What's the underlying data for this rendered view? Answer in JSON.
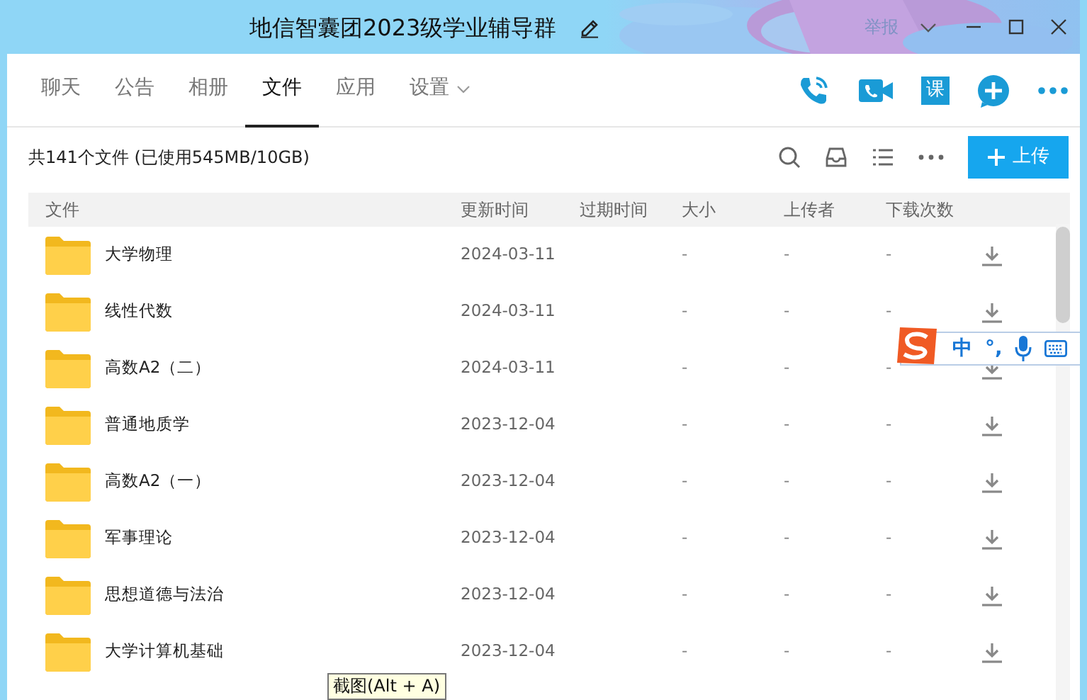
{
  "window": {
    "title": "地信智囊团2023级学业辅导群",
    "report": "举报"
  },
  "tabs": [
    {
      "label": "聊天",
      "selected": false
    },
    {
      "label": "公告",
      "selected": false
    },
    {
      "label": "相册",
      "selected": false
    },
    {
      "label": "文件",
      "selected": true
    },
    {
      "label": "应用",
      "selected": false
    },
    {
      "label": "设置",
      "selected": false,
      "kind": "dropdown"
    }
  ],
  "class_button": "课",
  "summary": "共141个文件 (已使用545MB/10GB)",
  "upload_button": "上传",
  "table": {
    "columns": [
      "文件",
      "更新时间",
      "过期时间",
      "大小",
      "上传者",
      "下载次数"
    ],
    "rows": [
      {
        "name": "大学物理",
        "updated": "2024-03-11",
        "size": "-",
        "uploader": "-",
        "downloads": "-"
      },
      {
        "name": "线性代数",
        "updated": "2024-03-11",
        "size": "-",
        "uploader": "-",
        "downloads": "-"
      },
      {
        "name": "高数A2（二）",
        "updated": "2024-03-11",
        "size": "-",
        "uploader": "-",
        "downloads": "-"
      },
      {
        "name": "普通地质学",
        "updated": "2023-12-04",
        "size": "-",
        "uploader": "-",
        "downloads": "-"
      },
      {
        "name": "高数A2（一）",
        "updated": "2023-12-04",
        "size": "-",
        "uploader": "-",
        "downloads": "-"
      },
      {
        "name": "军事理论",
        "updated": "2023-12-04",
        "size": "-",
        "uploader": "-",
        "downloads": "-"
      },
      {
        "name": "思想道德与法治",
        "updated": "2023-12-04",
        "size": "-",
        "uploader": "-",
        "downloads": "-"
      },
      {
        "name": "大学计算机基础",
        "updated": "2023-12-04",
        "size": "-",
        "uploader": "-",
        "downloads": "-"
      }
    ]
  },
  "ime_toolbar": {
    "mode": "中",
    "punctuation": "°,"
  },
  "tooltip": "截图(Alt + A)"
}
